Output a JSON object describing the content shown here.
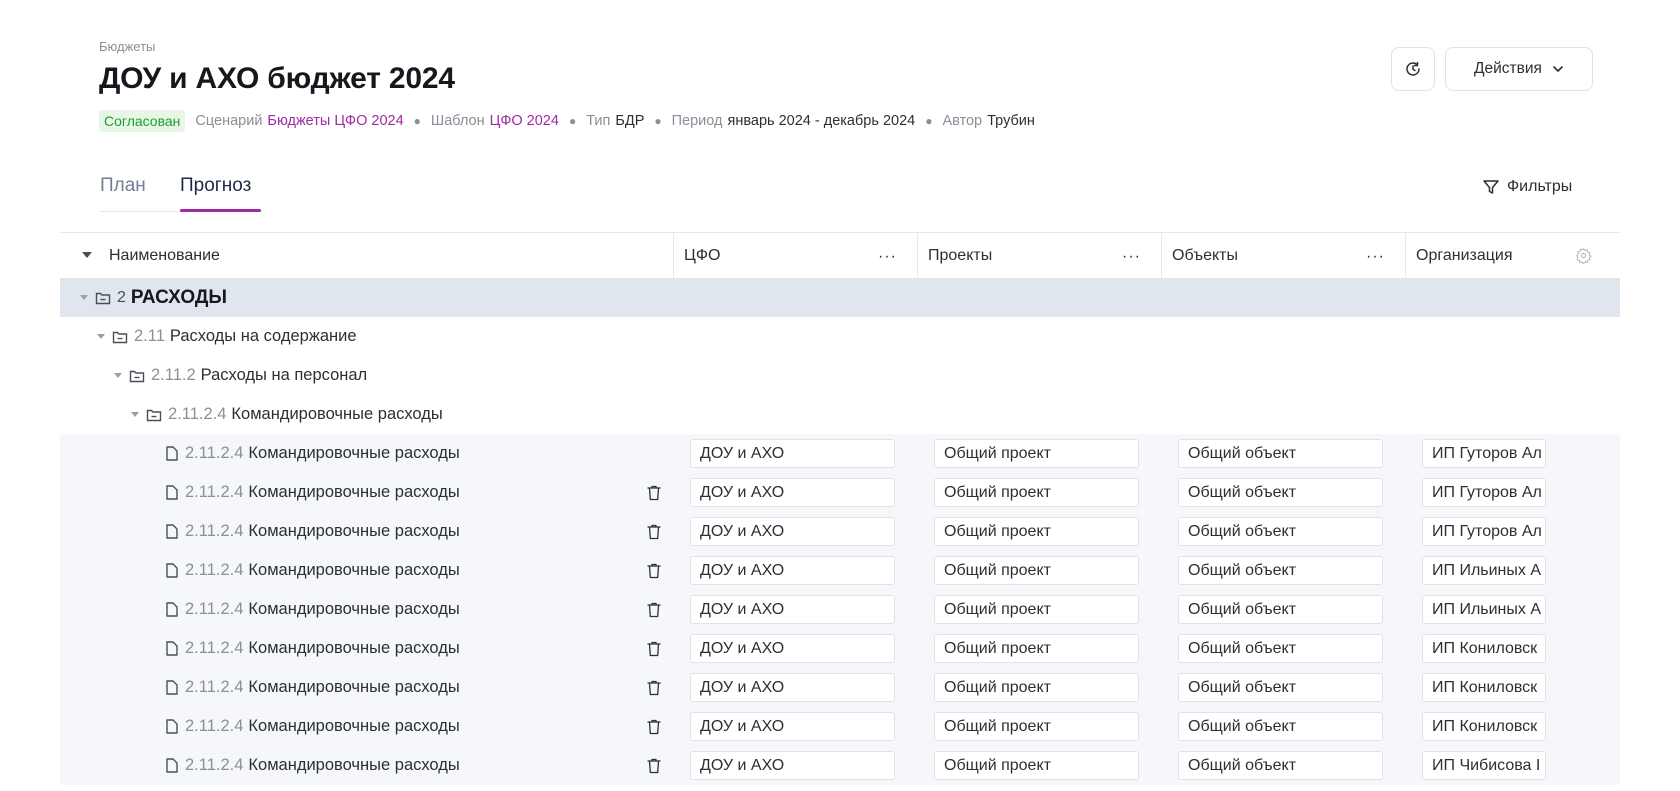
{
  "header": {
    "breadcrumb": "Бюджеты",
    "title": "ДОУ и АХО бюджет 2024",
    "status": "Согласован",
    "meta": [
      {
        "label": "Сценарий",
        "value": "Бюджеты ЦФО 2024"
      },
      {
        "label": "Шаблон",
        "value": "ЦФО 2024"
      },
      {
        "label": "Тип",
        "value": "БДР"
      },
      {
        "label": "Период",
        "value": "январь 2024 - декабрь 2024"
      },
      {
        "label": "Автор",
        "value": "Трубин"
      }
    ],
    "actions_label": "Действия",
    "history_icon": "history-clock-icon"
  },
  "tabs": [
    {
      "label": "План",
      "active": false
    },
    {
      "label": "Прогноз",
      "active": true
    }
  ],
  "filters_label": "Фильтры",
  "colors": {
    "accent": "#a02aa4",
    "status_bg": "#e7f6e7",
    "status_text": "#1e9e2a",
    "group_row_bg": "#e0e6ee"
  },
  "table": {
    "columns": [
      {
        "label": "Наименование"
      },
      {
        "label": "ЦФО",
        "menu": "···"
      },
      {
        "label": "Проекты",
        "menu": "···"
      },
      {
        "label": "Объекты",
        "menu": "···"
      },
      {
        "label": "Организация"
      }
    ],
    "groups": [
      {
        "code": "2",
        "name": "РАСХОДЫ"
      },
      {
        "code": "2.11",
        "name": "Расходы на содержание"
      },
      {
        "code": "2.11.2",
        "name": "Расходы на персонал"
      },
      {
        "code": "2.11.2.4",
        "name": "Командировочные расходы"
      }
    ],
    "rows": [
      {
        "code": "2.11.2.4",
        "name": "Командировочные расходы",
        "cfo": "ДОУ и АХО",
        "project": "Общий проект",
        "object": "Общий объект",
        "org": "ИП Гуторов Ал",
        "deletable": false
      },
      {
        "code": "2.11.2.4",
        "name": "Командировочные расходы",
        "cfo": "ДОУ и АХО",
        "project": "Общий проект",
        "object": "Общий объект",
        "org": "ИП Гуторов Ал",
        "deletable": true
      },
      {
        "code": "2.11.2.4",
        "name": "Командировочные расходы",
        "cfo": "ДОУ и АХО",
        "project": "Общий проект",
        "object": "Общий объект",
        "org": "ИП Гуторов Ал",
        "deletable": true
      },
      {
        "code": "2.11.2.4",
        "name": "Командировочные расходы",
        "cfo": "ДОУ и АХО",
        "project": "Общий проект",
        "object": "Общий объект",
        "org": "ИП Ильиных А",
        "deletable": true
      },
      {
        "code": "2.11.2.4",
        "name": "Командировочные расходы",
        "cfo": "ДОУ и АХО",
        "project": "Общий проект",
        "object": "Общий объект",
        "org": "ИП Ильиных А",
        "deletable": true
      },
      {
        "code": "2.11.2.4",
        "name": "Командировочные расходы",
        "cfo": "ДОУ и АХО",
        "project": "Общий проект",
        "object": "Общий объект",
        "org": "ИП Кониловск",
        "deletable": true
      },
      {
        "code": "2.11.2.4",
        "name": "Командировочные расходы",
        "cfo": "ДОУ и АХО",
        "project": "Общий проект",
        "object": "Общий объект",
        "org": "ИП Кониловск",
        "deletable": true
      },
      {
        "code": "2.11.2.4",
        "name": "Командировочные расходы",
        "cfo": "ДОУ и АХО",
        "project": "Общий проект",
        "object": "Общий объект",
        "org": "ИП Кониловск",
        "deletable": true
      },
      {
        "code": "2.11.2.4",
        "name": "Командировочные расходы",
        "cfo": "ДОУ и АХО",
        "project": "Общий проект",
        "object": "Общий объект",
        "org": "ИП Чибисова I",
        "deletable": true
      }
    ]
  }
}
